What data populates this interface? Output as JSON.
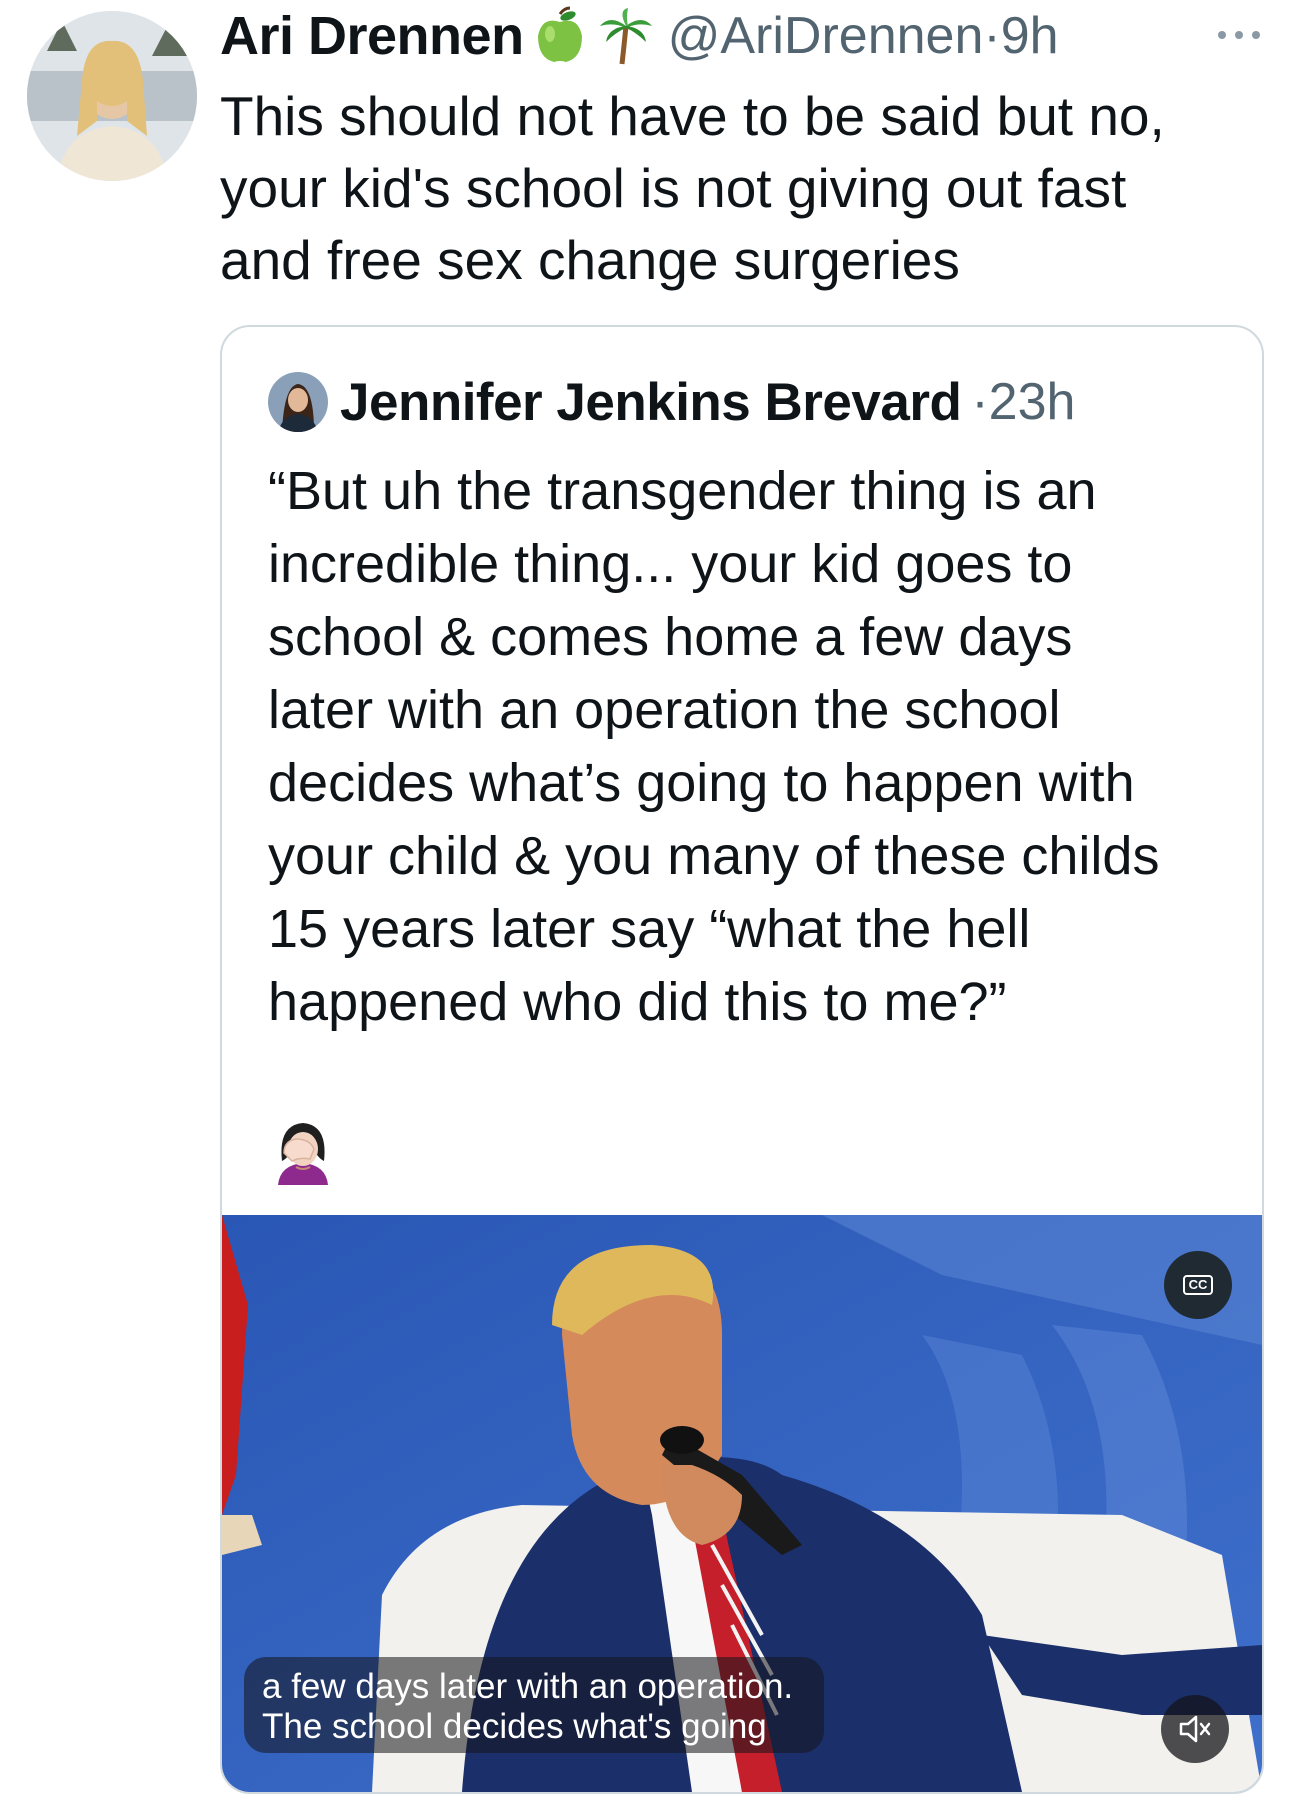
{
  "tweet": {
    "author_name": "Ari Drennen",
    "handle_time": "@AriDrennen·9h",
    "emojis": [
      "apple-icon",
      "palm-tree-icon"
    ],
    "text_lines": [
      "This should not have to be said but no,",
      "your kid's school is not giving out fast",
      "and free sex change surgeries"
    ]
  },
  "quote": {
    "author_name": "Jennifer Jenkins Brevard",
    "time": "·23h",
    "text_lines": [
      "“But uh the transgender thing is an",
      "incredible thing... your kid goes to",
      "school & comes home a few days",
      "later with an operation the school",
      "decides what’s going to happen with",
      "your child & you many of these childs",
      "15 years later say “what the hell",
      "happened who did this to me?”"
    ],
    "emoji": "woman-facepalming-icon",
    "video": {
      "cc_label": "CC",
      "caption_lines": [
        "a few days later with an operation.",
        "The school decides what's going"
      ],
      "mute_icon": "volume-muted-icon"
    }
  },
  "colors": {
    "text": "#0f1419",
    "secondary": "#536471",
    "border": "#cfd9de",
    "video_bg": "#2f5fb8"
  }
}
